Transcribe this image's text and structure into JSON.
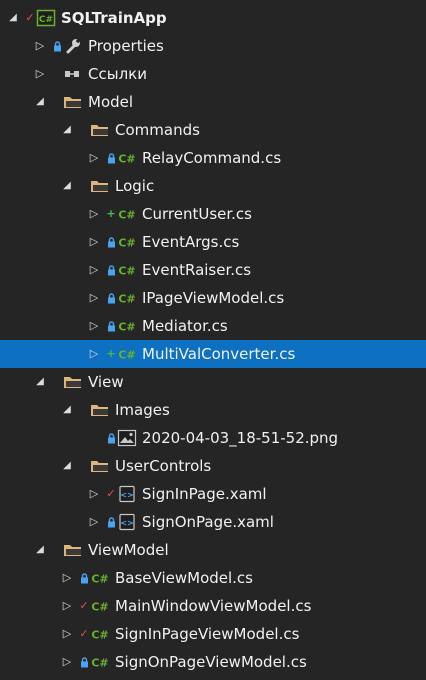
{
  "tree": [
    {
      "level": 0,
      "expander": "down",
      "status": "check",
      "icon": "csharp-project-icon",
      "label": "SQLTrainApp",
      "bold": true
    },
    {
      "level": 1,
      "expander": "right",
      "status": "lock",
      "icon": "wrench-icon",
      "label": "Properties"
    },
    {
      "level": 1,
      "expander": "right",
      "status": "",
      "icon": "references-icon",
      "label": "Ссылки"
    },
    {
      "level": 1,
      "expander": "down",
      "status": "",
      "icon": "folder-open-icon",
      "label": "Model"
    },
    {
      "level": 2,
      "expander": "down",
      "status": "",
      "icon": "folder-open-icon",
      "label": "Commands"
    },
    {
      "level": 3,
      "expander": "right",
      "status": "lock",
      "icon": "csharp-file-icon",
      "label": "RelayCommand.cs"
    },
    {
      "level": 2,
      "expander": "down",
      "status": "",
      "icon": "folder-open-icon",
      "label": "Logic"
    },
    {
      "level": 3,
      "expander": "right",
      "status": "add",
      "icon": "csharp-file-icon",
      "label": "CurrentUser.cs"
    },
    {
      "level": 3,
      "expander": "right",
      "status": "lock",
      "icon": "csharp-file-icon",
      "label": "EventArgs.cs"
    },
    {
      "level": 3,
      "expander": "right",
      "status": "lock",
      "icon": "csharp-file-icon",
      "label": "EventRaiser.cs"
    },
    {
      "level": 3,
      "expander": "right",
      "status": "lock",
      "icon": "csharp-file-icon",
      "label": "IPageViewModel.cs"
    },
    {
      "level": 3,
      "expander": "right",
      "status": "lock",
      "icon": "csharp-file-icon",
      "label": "Mediator.cs"
    },
    {
      "level": 3,
      "expander": "right",
      "status": "add",
      "icon": "csharp-file-icon",
      "label": "MultiValConverter.cs",
      "selected": true
    },
    {
      "level": 1,
      "expander": "down",
      "status": "",
      "icon": "folder-open-icon",
      "label": "View"
    },
    {
      "level": 2,
      "expander": "down",
      "status": "",
      "icon": "folder-open-icon",
      "label": "Images"
    },
    {
      "level": 3,
      "expander": "",
      "status": "lock",
      "icon": "image-file-icon",
      "label": "2020-04-03_18-51-52.png"
    },
    {
      "level": 2,
      "expander": "down",
      "status": "",
      "icon": "folder-open-icon",
      "label": "UserControls"
    },
    {
      "level": 3,
      "expander": "right",
      "status": "check",
      "icon": "xaml-file-icon",
      "label": "SignInPage.xaml"
    },
    {
      "level": 3,
      "expander": "right",
      "status": "lock",
      "icon": "xaml-file-icon",
      "label": "SignOnPage.xaml"
    },
    {
      "level": 1,
      "expander": "down",
      "status": "",
      "icon": "folder-open-icon",
      "label": "ViewModel"
    },
    {
      "level": 2,
      "expander": "right",
      "status": "lock",
      "icon": "csharp-file-icon",
      "label": "BaseViewModel.cs"
    },
    {
      "level": 2,
      "expander": "right",
      "status": "check",
      "icon": "csharp-file-icon",
      "label": "MainWindowViewModel.cs"
    },
    {
      "level": 2,
      "expander": "right",
      "status": "check",
      "icon": "csharp-file-icon",
      "label": "SignInPageViewModel.cs"
    },
    {
      "level": 2,
      "expander": "right",
      "status": "lock",
      "icon": "csharp-file-icon",
      "label": "SignOnPageViewModel.cs"
    }
  ],
  "colors": {
    "background": "#252526",
    "selection": "#0e70c0",
    "text": "#f1f1f1",
    "csharp": "#68b22d",
    "folder": "#dcb67a",
    "lock": "#4aa3f0",
    "check": "#e05252",
    "add": "#4cbb4c"
  }
}
